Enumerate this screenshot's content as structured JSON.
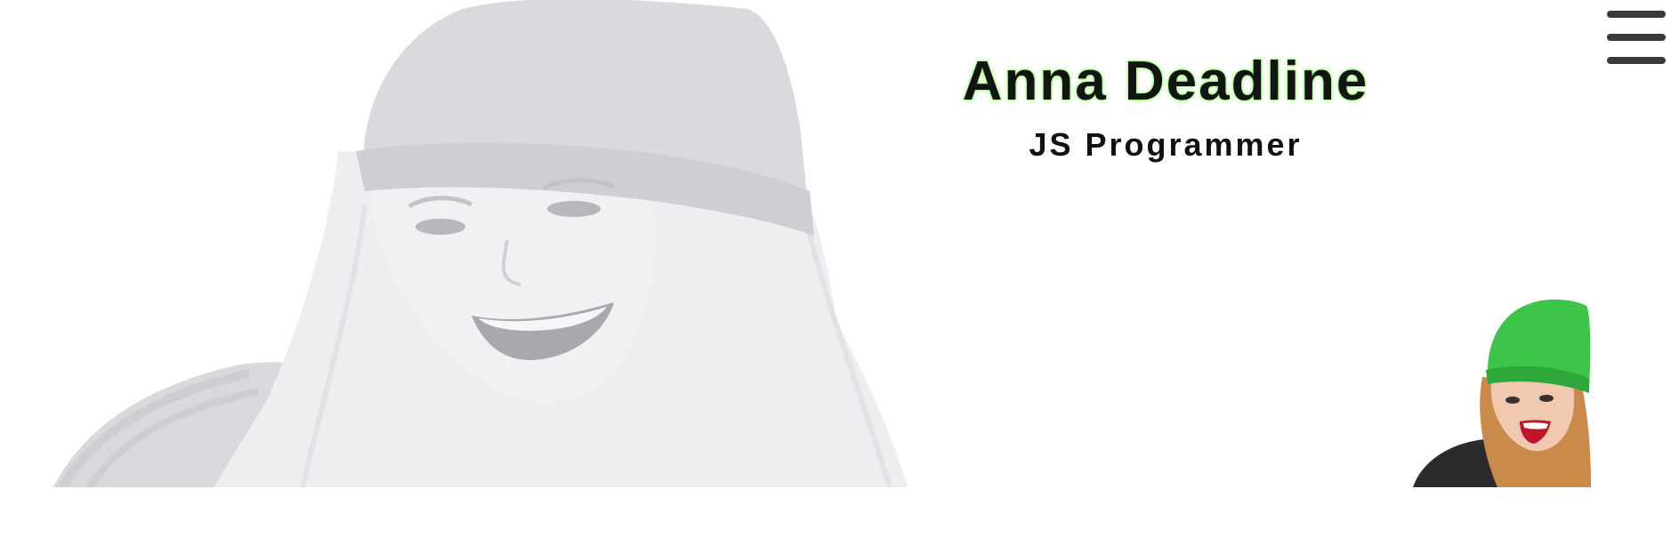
{
  "header": {
    "name": "Anna Deadline",
    "role": "JS Programmer"
  },
  "menu": {
    "icon": "hamburger-menu-icon"
  },
  "colors": {
    "name_glow": "#79ff4a",
    "text": "#141414",
    "hat_green": "#3cc548",
    "portrait_gray": "#d9d8dc",
    "menu_bars": "#3a3a3a"
  }
}
